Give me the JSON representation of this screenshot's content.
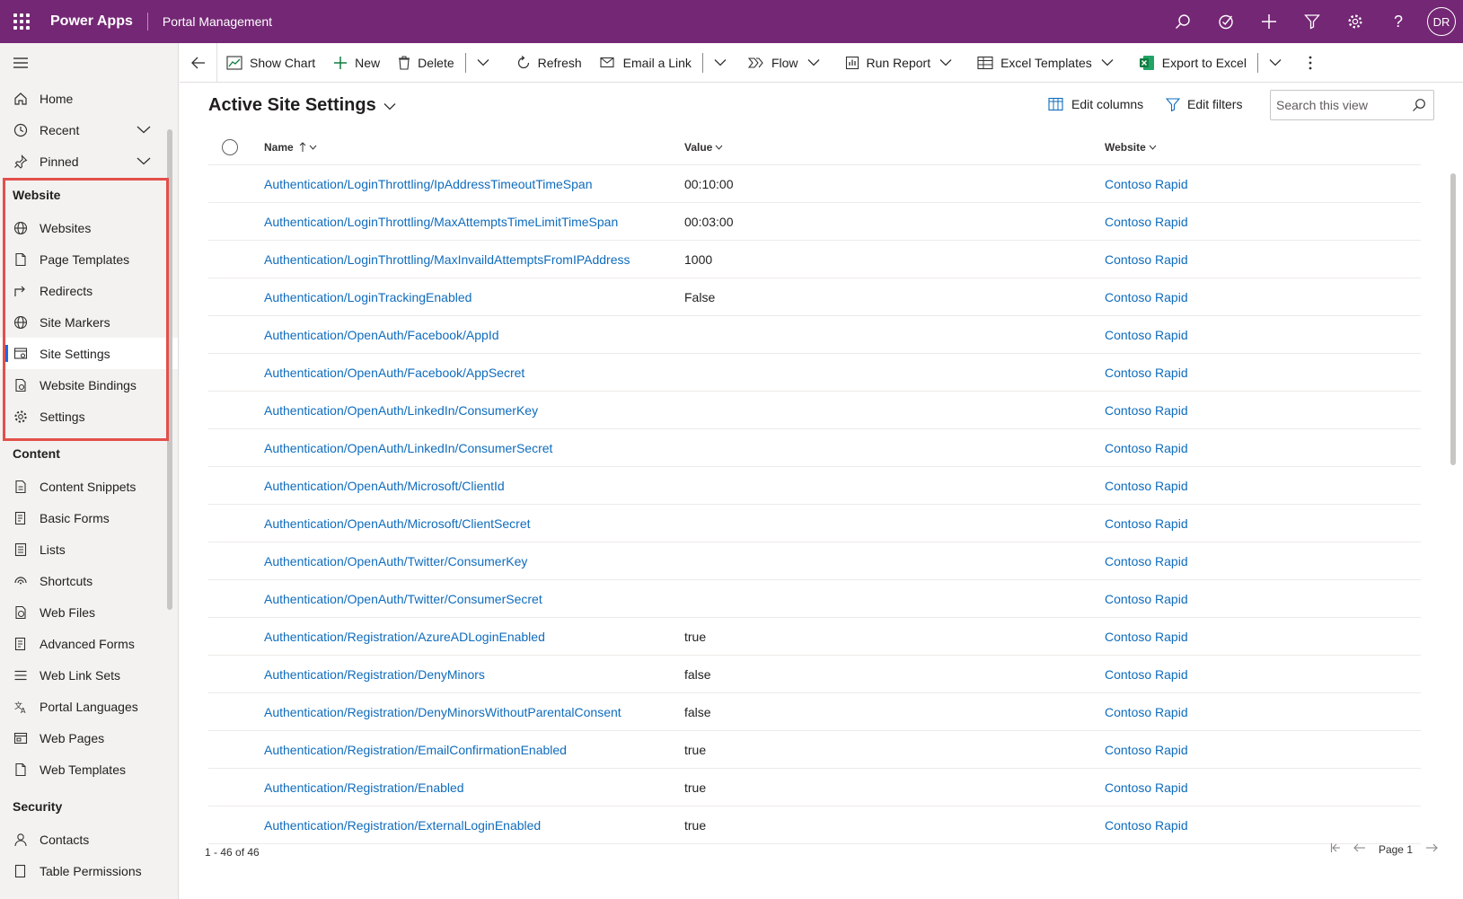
{
  "topbar": {
    "app_name": "Power Apps",
    "app_subtitle": "Portal Management",
    "avatar": "DR",
    "icons": [
      "search-icon",
      "assistant-icon",
      "add-icon",
      "filter-icon",
      "settings-icon",
      "help-icon"
    ]
  },
  "sidebar": {
    "top_items": [
      {
        "label": "Home",
        "icon": "home-icon"
      },
      {
        "label": "Recent",
        "icon": "clock-icon"
      },
      {
        "label": "Pinned",
        "icon": "pin-icon"
      }
    ],
    "groups": [
      {
        "title": "Website",
        "items": [
          {
            "label": "Websites",
            "icon": "globe-icon"
          },
          {
            "label": "Page Templates",
            "icon": "page-icon"
          },
          {
            "label": "Redirects",
            "icon": "redirect-icon"
          },
          {
            "label": "Site Markers",
            "icon": "globe-icon"
          },
          {
            "label": "Site Settings",
            "icon": "site-settings-icon",
            "active": true
          },
          {
            "label": "Website Bindings",
            "icon": "bindings-icon"
          },
          {
            "label": "Settings",
            "icon": "gear-icon"
          }
        ]
      },
      {
        "title": "Content",
        "items": [
          {
            "label": "Content Snippets",
            "icon": "snippet-icon"
          },
          {
            "label": "Basic Forms",
            "icon": "form-icon"
          },
          {
            "label": "Lists",
            "icon": "list-icon"
          },
          {
            "label": "Shortcuts",
            "icon": "shortcut-icon"
          },
          {
            "label": "Web Files",
            "icon": "web-file-icon"
          },
          {
            "label": "Advanced Forms",
            "icon": "form-icon"
          },
          {
            "label": "Web Link Sets",
            "icon": "link-set-icon"
          },
          {
            "label": "Portal Languages",
            "icon": "language-icon"
          },
          {
            "label": "Web Pages",
            "icon": "web-page-icon"
          },
          {
            "label": "Web Templates",
            "icon": "page-icon"
          }
        ]
      },
      {
        "title": "Security",
        "items": [
          {
            "label": "Contacts",
            "icon": "person-icon"
          },
          {
            "label": "Table Permissions",
            "icon": "permissions-icon"
          }
        ]
      }
    ]
  },
  "commandbar": {
    "show_chart": "Show Chart",
    "new": "New",
    "delete": "Delete",
    "refresh": "Refresh",
    "email_link": "Email a Link",
    "flow": "Flow",
    "run_report": "Run Report",
    "excel_templates": "Excel Templates",
    "export_excel": "Export to Excel"
  },
  "view": {
    "title": "Active Site Settings",
    "edit_columns": "Edit columns",
    "edit_filters": "Edit filters",
    "search_placeholder": "Search this view"
  },
  "grid": {
    "columns": {
      "name": "Name",
      "value": "Value",
      "website": "Website"
    },
    "rows": [
      {
        "name": "Authentication/LoginThrottling/IpAddressTimeoutTimeSpan",
        "value": "00:10:00",
        "website": "Contoso Rapid"
      },
      {
        "name": "Authentication/LoginThrottling/MaxAttemptsTimeLimitTimeSpan",
        "value": "00:03:00",
        "website": "Contoso Rapid"
      },
      {
        "name": "Authentication/LoginThrottling/MaxInvaildAttemptsFromIPAddress",
        "value": "1000",
        "website": "Contoso Rapid"
      },
      {
        "name": "Authentication/LoginTrackingEnabled",
        "value": "False",
        "website": "Contoso Rapid"
      },
      {
        "name": "Authentication/OpenAuth/Facebook/AppId",
        "value": "",
        "website": "Contoso Rapid"
      },
      {
        "name": "Authentication/OpenAuth/Facebook/AppSecret",
        "value": "",
        "website": "Contoso Rapid"
      },
      {
        "name": "Authentication/OpenAuth/LinkedIn/ConsumerKey",
        "value": "",
        "website": "Contoso Rapid"
      },
      {
        "name": "Authentication/OpenAuth/LinkedIn/ConsumerSecret",
        "value": "",
        "website": "Contoso Rapid"
      },
      {
        "name": "Authentication/OpenAuth/Microsoft/ClientId",
        "value": "",
        "website": "Contoso Rapid"
      },
      {
        "name": "Authentication/OpenAuth/Microsoft/ClientSecret",
        "value": "",
        "website": "Contoso Rapid"
      },
      {
        "name": "Authentication/OpenAuth/Twitter/ConsumerKey",
        "value": "",
        "website": "Contoso Rapid"
      },
      {
        "name": "Authentication/OpenAuth/Twitter/ConsumerSecret",
        "value": "",
        "website": "Contoso Rapid"
      },
      {
        "name": "Authentication/Registration/AzureADLoginEnabled",
        "value": "true",
        "website": "Contoso Rapid"
      },
      {
        "name": "Authentication/Registration/DenyMinors",
        "value": "false",
        "website": "Contoso Rapid"
      },
      {
        "name": "Authentication/Registration/DenyMinorsWithoutParentalConsent",
        "value": "false",
        "website": "Contoso Rapid"
      },
      {
        "name": "Authentication/Registration/EmailConfirmationEnabled",
        "value": "true",
        "website": "Contoso Rapid"
      },
      {
        "name": "Authentication/Registration/Enabled",
        "value": "true",
        "website": "Contoso Rapid"
      },
      {
        "name": "Authentication/Registration/ExternalLoginEnabled",
        "value": "true",
        "website": "Contoso Rapid"
      }
    ]
  },
  "footer": {
    "record_count": "1 - 46 of 46",
    "page_label": "Page 1"
  },
  "colors": {
    "header": "#742774",
    "link": "#0f6cbd",
    "highlight": "#e3504a",
    "active_indicator": "#2266e3"
  }
}
